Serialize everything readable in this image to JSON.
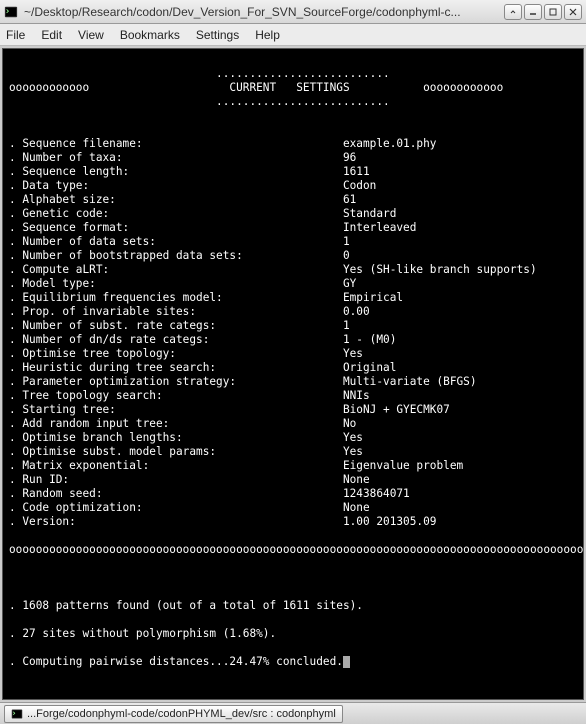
{
  "window": {
    "title": "~/Desktop/Research/codon/Dev_Version_For_SVN_SourceForge/codonphyml-c..."
  },
  "menu": {
    "file": "File",
    "edit": "Edit",
    "view": "View",
    "bookmarks": "Bookmarks",
    "settings": "Settings",
    "help": "Help"
  },
  "header": {
    "dots": "..........................",
    "title": "CURRENT   SETTINGS"
  },
  "dividers": {
    "segment": "oooooooooooo",
    "full": "oooooooooooooooooooooooooooooooooooooooooooooooooooooooooooooooooooooooooooooooooooooo"
  },
  "settings": [
    {
      "label": "Sequence filename:",
      "value": "example.01.phy"
    },
    {
      "label": "Number of taxa:",
      "value": "96"
    },
    {
      "label": "Sequence length:",
      "value": "1611"
    },
    {
      "label": "Data type:",
      "value": "Codon"
    },
    {
      "label": "Alphabet size:",
      "value": "61"
    },
    {
      "label": "Genetic code:",
      "value": "Standard"
    },
    {
      "label": "Sequence format:",
      "value": "Interleaved"
    },
    {
      "label": "Number of data sets:",
      "value": "1"
    },
    {
      "label": "Number of bootstrapped data sets:",
      "value": "0"
    },
    {
      "label": "Compute aLRT:",
      "value": "Yes (SH-like branch supports)"
    },
    {
      "label": "Model type:",
      "value": "GY"
    },
    {
      "label": "Equilibrium frequencies model:",
      "value": "Empirical"
    },
    {
      "label": "Prop. of invariable sites:",
      "value": "0.00"
    },
    {
      "label": "Number of subst. rate categs:",
      "value": "1"
    },
    {
      "label": "Number of dn/ds rate categs:",
      "value": "1 - (M0)"
    },
    {
      "label": "Optimise tree topology:",
      "value": "Yes"
    },
    {
      "label": "Heuristic during tree search:",
      "value": "Original"
    },
    {
      "label": "Parameter optimization strategy:",
      "value": "Multi-variate (BFGS)"
    },
    {
      "label": "Tree topology search:",
      "value": "NNIs"
    },
    {
      "label": "Starting tree:",
      "value": "BioNJ + GYECMK07"
    },
    {
      "label": "Add random input tree:",
      "value": "No"
    },
    {
      "label": "Optimise branch lengths:",
      "value": "Yes"
    },
    {
      "label": "Optimise subst. model params:",
      "value": "Yes"
    },
    {
      "label": "Matrix exponential:",
      "value": "Eigenvalue problem"
    },
    {
      "label": "Run ID:",
      "value": "None"
    },
    {
      "label": "Random seed:",
      "value": "1243864071"
    },
    {
      "label": "Code optimization:",
      "value": "None"
    },
    {
      "label": "Version:",
      "value": "1.00 201305.09"
    }
  ],
  "status": {
    "line1": ". 1608 patterns found (out of a total of 1611 sites).",
    "line2": ". 27 sites without polymorphism (1.68%).",
    "line3": ". Computing pairwise distances...24.47% concluded."
  },
  "taskbar": {
    "item": "...Forge/codonphyml-code/codonPHYML_dev/src : codonphyml"
  }
}
